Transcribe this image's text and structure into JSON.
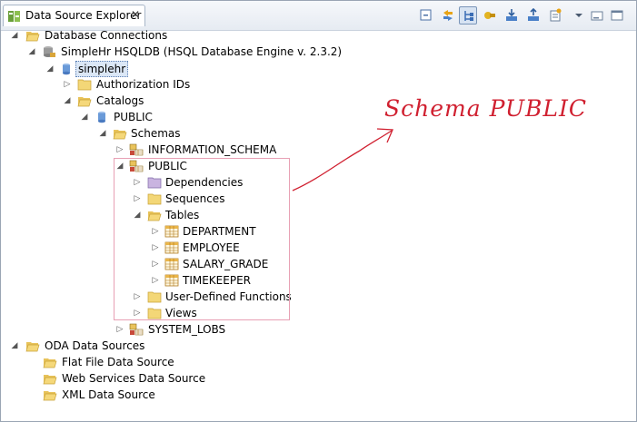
{
  "view": {
    "title": "Data Source Explorer",
    "close_glyph": "✕",
    "toolbar_icons": [
      "collapse-all-icon",
      "link-with-editor-icon",
      "tree-view-icon",
      "connect-icon",
      "import-icon",
      "export-icon",
      "new-icon",
      "view-menu-icon",
      "minimize-icon",
      "maximize-icon"
    ]
  },
  "tree": {
    "database_connections": "Database Connections",
    "connection": "SimpleHr HSQLDB (HSQL Database Engine v. 2.3.2)",
    "database": "simplehr",
    "authorization_ids": "Authorization IDs",
    "catalogs": "Catalogs",
    "catalog_public": "PUBLIC",
    "schemas": "Schemas",
    "information_schema": "INFORMATION_SCHEMA",
    "schema_public": "PUBLIC",
    "dependencies": "Dependencies",
    "sequences": "Sequences",
    "tables": "Tables",
    "table_items": [
      "DEPARTMENT",
      "EMPLOYEE",
      "SALARY_GRADE",
      "TIMEKEEPER"
    ],
    "udf": "User-Defined Functions",
    "views": "Views",
    "system_lobs": "SYSTEM_LOBS",
    "oda_data_sources": "ODA Data Sources",
    "oda_items": [
      "Flat File Data Source",
      "Web Services Data Source",
      "XML Data Source"
    ]
  },
  "annotation": {
    "text": "Schema PUBLIC",
    "color": "#d02030"
  }
}
